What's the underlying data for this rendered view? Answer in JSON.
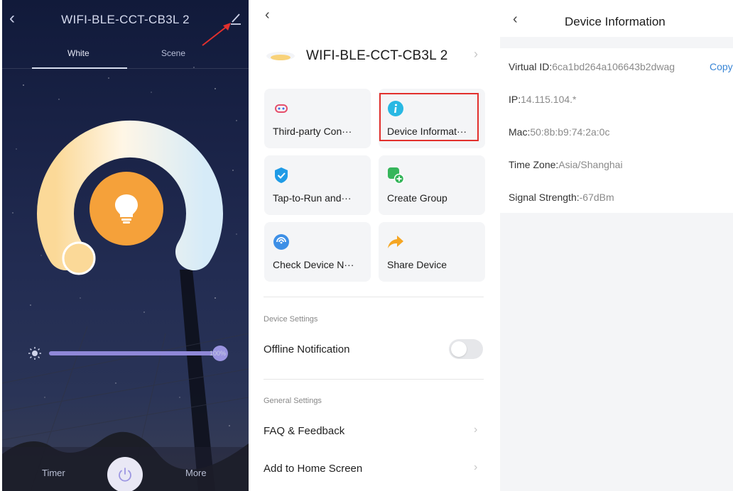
{
  "light_panel": {
    "title": "WIFI-BLE-CCT-CB3L 2",
    "tabs": [
      "White",
      "Scene"
    ],
    "brightness_value": "100%",
    "bottom": {
      "timer": "Timer",
      "more": "More"
    }
  },
  "settings_panel": {
    "device_name": "WIFI-BLE-CCT-CB3L 2",
    "tiles": [
      {
        "label": "Third-party Con···",
        "icon": "link-icon",
        "color": "#e64e6b"
      },
      {
        "label": "Device Informat···",
        "icon": "info-icon",
        "color": "#29b8e3"
      },
      {
        "label": "Tap-to-Run and···",
        "icon": "check-shield-icon",
        "color": "#1f9be6"
      },
      {
        "label": "Create Group",
        "icon": "add-group-icon",
        "color": "#36b55b"
      },
      {
        "label": "Check Device N···",
        "icon": "network-icon",
        "color": "#3d8fe6"
      },
      {
        "label": "Share Device",
        "icon": "share-icon",
        "color": "#f5a623"
      }
    ],
    "device_settings": {
      "title": "Device Settings",
      "offline_notification": "Offline Notification"
    },
    "general_settings": {
      "title": "General Settings",
      "faq": "FAQ & Feedback",
      "add_home": "Add to Home Screen"
    }
  },
  "info_panel": {
    "title": "Device Information",
    "copy": "Copy",
    "rows": [
      {
        "key": "Virtual ID:",
        "value": "6ca1bd264a106643b2dwag"
      },
      {
        "key": "IP:",
        "value": "14.115.104.*"
      },
      {
        "key": "Mac:",
        "value": "50:8b:b9:74:2a:0c"
      },
      {
        "key": "Time Zone:",
        "value": "Asia/Shanghai"
      },
      {
        "key": "Signal Strength:",
        "value": "-67dBm"
      }
    ]
  },
  "colors": {
    "accent_orange": "#f5a13a",
    "slider": "#8f88d8",
    "highlight_red": "#e2302d",
    "link_blue": "#3a86d6"
  }
}
